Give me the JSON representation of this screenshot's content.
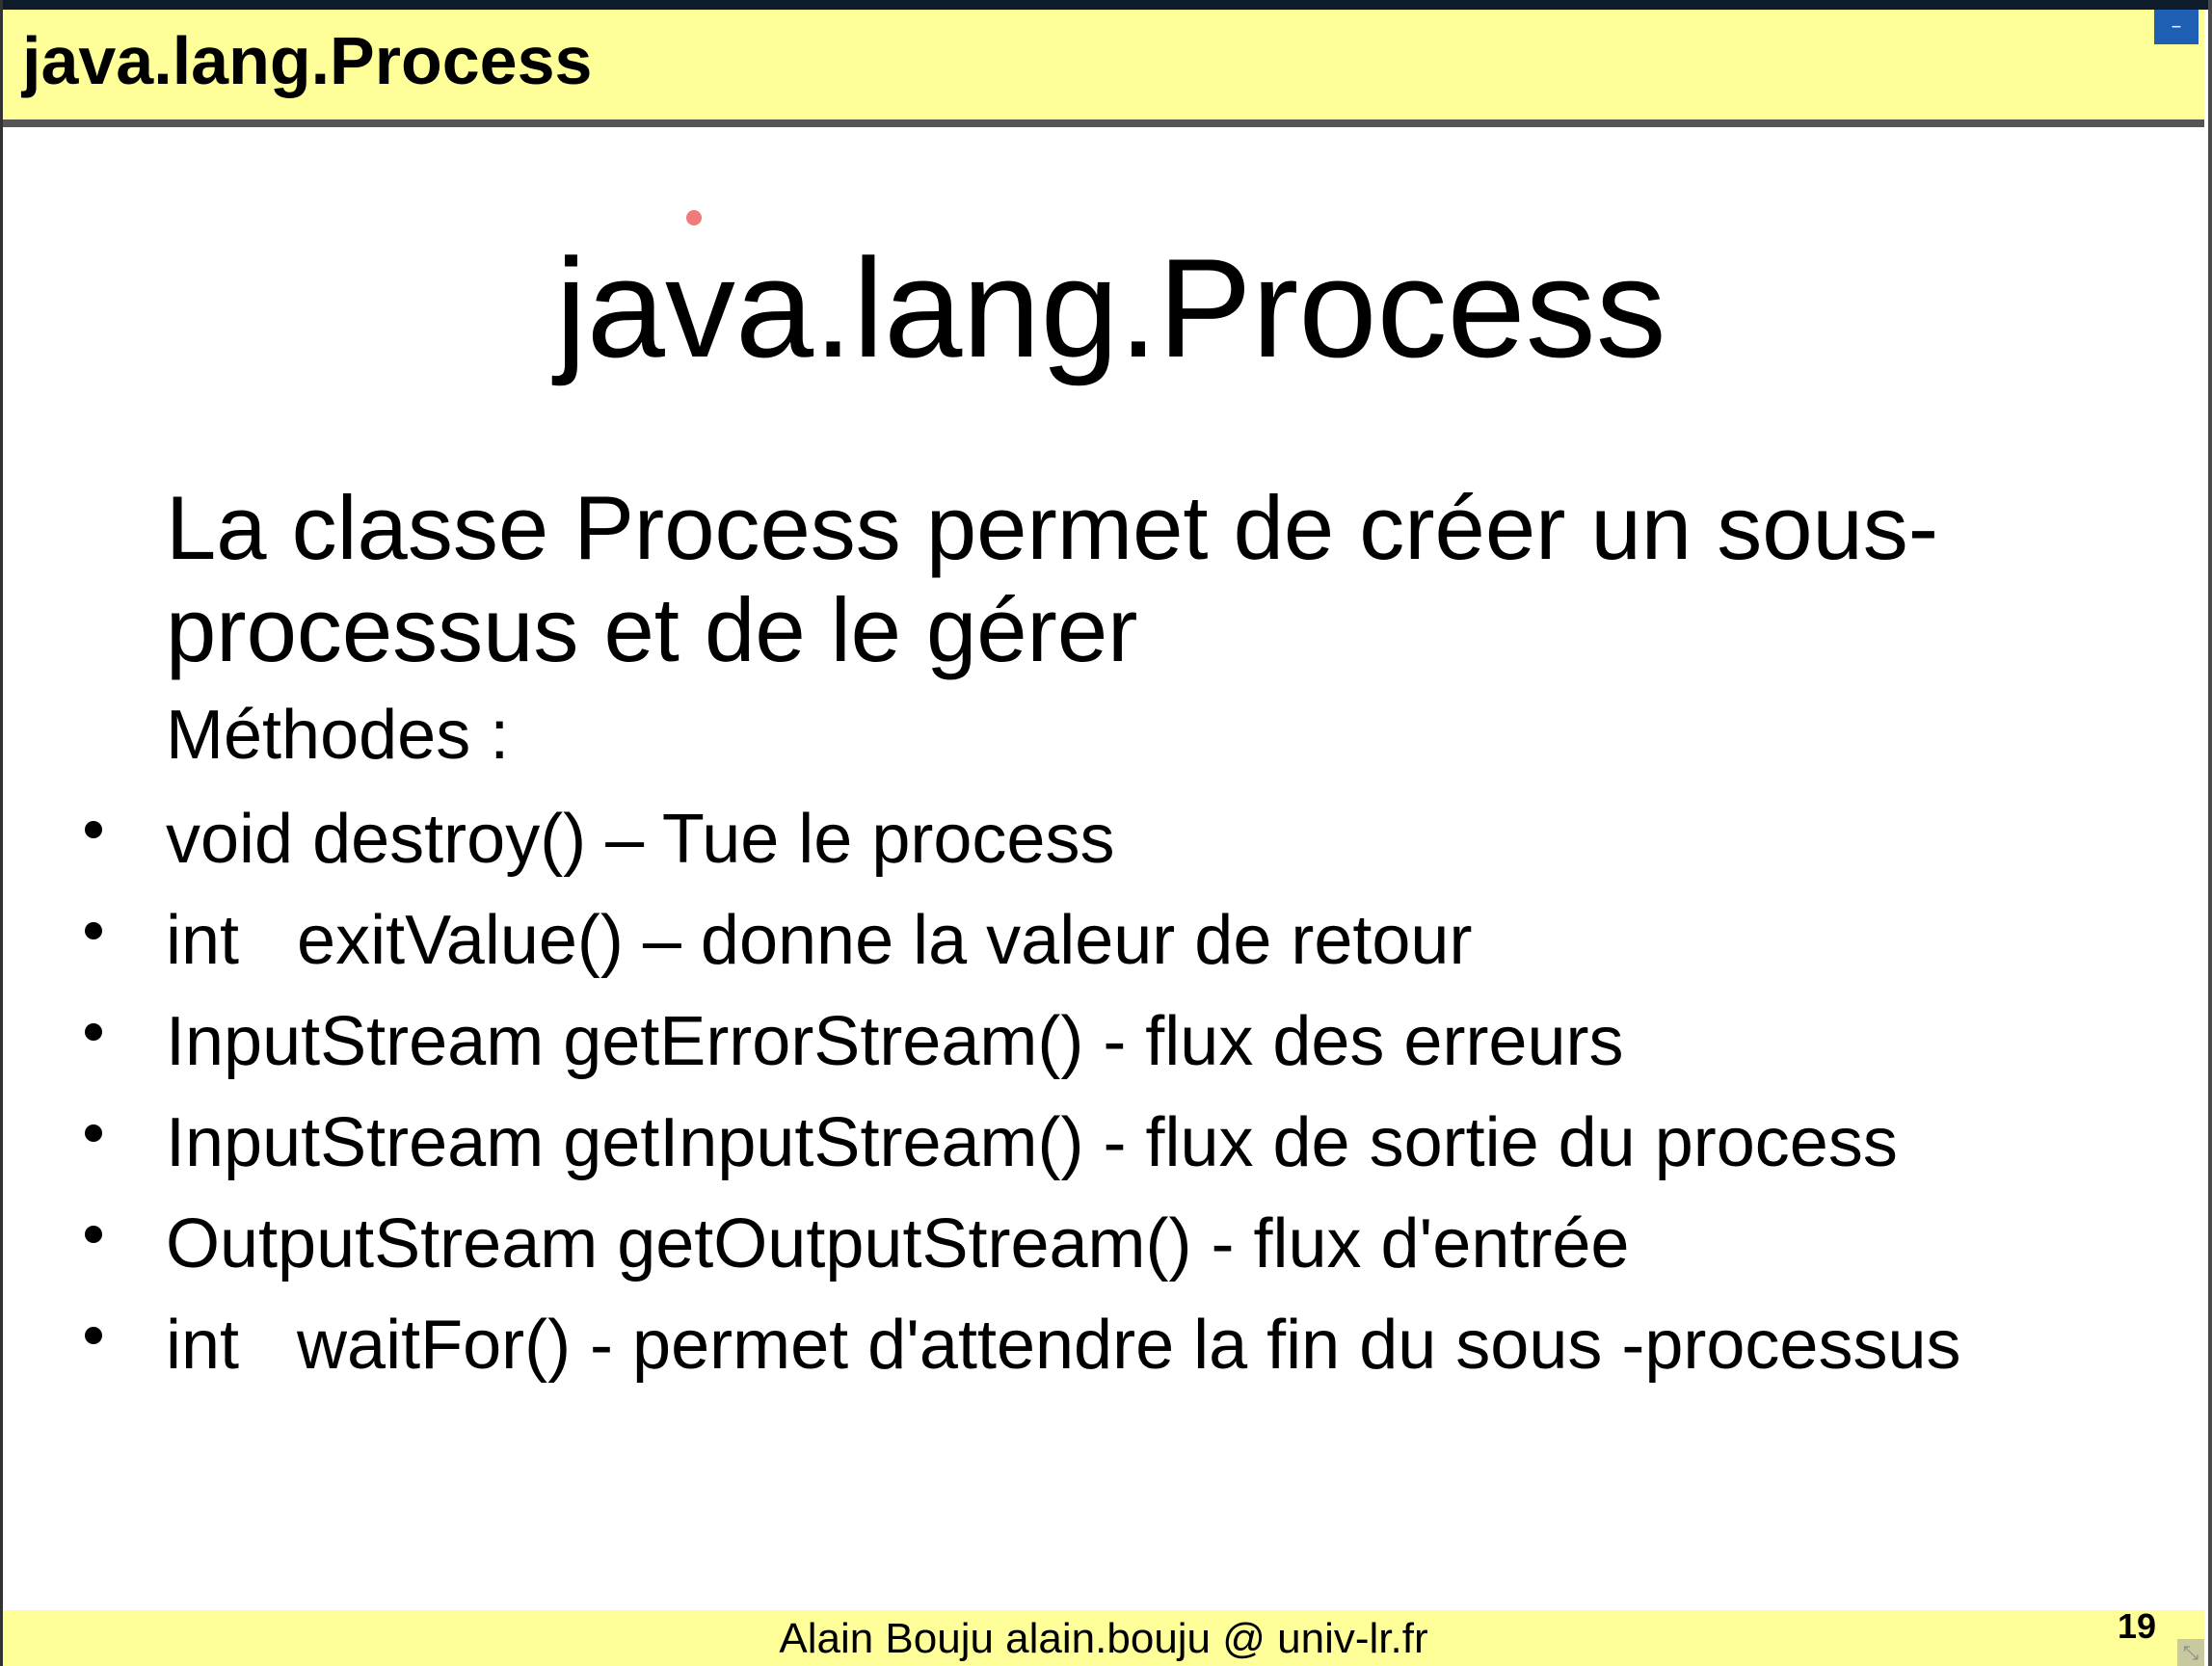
{
  "header": {
    "title": "java.lang.Process",
    "minimize_icon": "–"
  },
  "slide": {
    "title": "java.lang.Process",
    "intro": "La classe Process permet de créer un sous-processus et de le gérer",
    "methods_heading": "Méthodes :",
    "methods": [
      "void destroy() – Tue le process",
      "int   exitValue() – donne la valeur de retour",
      "InputStream getErrorStream() - flux des erreurs",
      "InputStream getInputStream() - flux de sortie du process",
      "OutputStream getOutputStream() - flux d'entrée",
      "int   waitFor() - permet d'attendre la fin du sous -processus"
    ]
  },
  "footer": {
    "author": "Alain Bouju alain.bouju @ univ-lr.fr",
    "page_number": "19"
  },
  "colors": {
    "header_background": "#ffff99",
    "footer_background": "#ffff99",
    "minimize_button": "#1e5fb3",
    "laser_pointer": "#f07a7a"
  },
  "icons": {
    "minimize": "minimize-icon",
    "resize": "resize-grip-icon"
  }
}
